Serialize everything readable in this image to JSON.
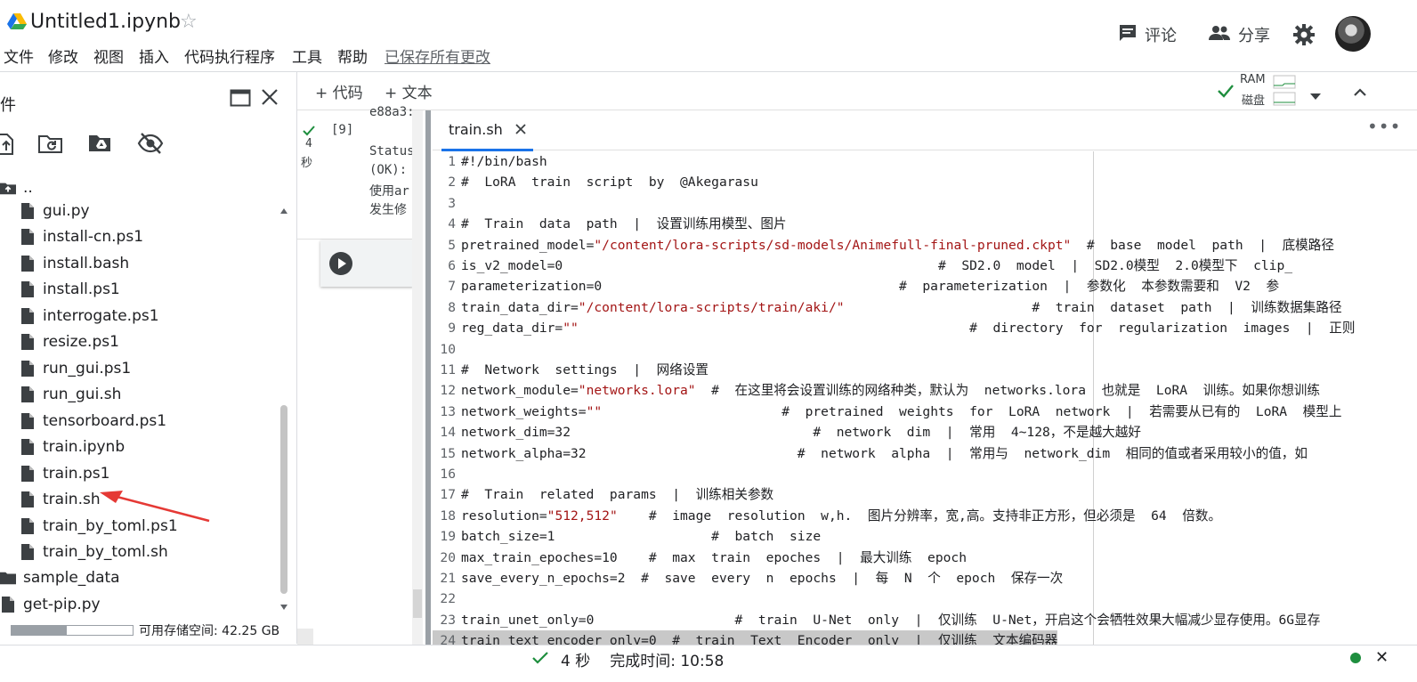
{
  "header": {
    "title": "Untitled1.ipynb",
    "menu": [
      "文件",
      "修改",
      "视图",
      "插入",
      "代码执行程序",
      "工具",
      "帮助"
    ],
    "saved_status": "已保存所有更改",
    "comment_label": "评论",
    "share_label": "分享"
  },
  "sidebar": {
    "title": "件",
    "parent_label": "..",
    "files": [
      "gui.py",
      "install-cn.ps1",
      "install.bash",
      "install.ps1",
      "interrogate.ps1",
      "resize.ps1",
      "run_gui.ps1",
      "run_gui.sh",
      "tensorboard.ps1",
      "train.ipynb",
      "train.ps1",
      "train.sh",
      "train_by_toml.ps1",
      "train_by_toml.sh"
    ],
    "folder": "sample_data",
    "extra_file": "get-pip.py",
    "storage_label": "可用存储空间: 42.25 GB"
  },
  "toolbar": {
    "add_code": "+ 代码",
    "add_text": "+ 文本",
    "ram_label": "RAM",
    "disk_label": "磁盘"
  },
  "cell": {
    "exec_count": "[9]",
    "duration_value": "4",
    "duration_unit": "秒",
    "output_lines": [
      "e88a3:",
      "Status",
      "(OK):",
      "使用ar",
      "发生修"
    ]
  },
  "editor": {
    "tab_name": "train.sh",
    "lines": [
      {
        "n": "1",
        "t": "#!/bin/bash"
      },
      {
        "n": "2",
        "t": "#  LoRA  train  script  by  @Akegarasu"
      },
      {
        "n": "3",
        "t": ""
      },
      {
        "n": "4",
        "t": "#  Train  data  path  |  设置训练用模型、图片"
      },
      {
        "n": "5",
        "pre": "pretrained_model=",
        "s": "\"/content/lora-scripts/sd-models/Animefull-final-pruned.ckpt\"",
        "post": "  #  base  model  path  |  底模路径"
      },
      {
        "n": "6",
        "t": "is_v2_model=0                                                #  SD2.0  model  |  SD2.0模型  2.0模型下  clip_"
      },
      {
        "n": "7",
        "t": "parameterization=0                                      #  parameterization  |  参数化  本参数需要和  V2  参"
      },
      {
        "n": "8",
        "pre": "train_data_dir=",
        "s": "\"/content/lora-scripts/train/aki/\"",
        "post": "                        #  train  dataset  path  |  训练数据集路径"
      },
      {
        "n": "9",
        "pre": "reg_data_dir=",
        "s": "\"\"",
        "post": "                                                  #  directory  for  regularization  images  |  正则"
      },
      {
        "n": "10",
        "t": ""
      },
      {
        "n": "11",
        "t": "#  Network  settings  |  网络设置"
      },
      {
        "n": "12",
        "pre": "network_module=",
        "s": "\"networks.lora\"",
        "post": "  #  在这里将会设置训练的网络种类，默认为  networks.lora  也就是  LoRA  训练。如果你想训练"
      },
      {
        "n": "13",
        "pre": "network_weights=",
        "s": "\"\"",
        "post": "                       #  pretrained  weights  for  LoRA  network  |  若需要从已有的  LoRA  模型上"
      },
      {
        "n": "14",
        "t": "network_dim=32                               #  network  dim  |  常用  4~128，不是越大越好"
      },
      {
        "n": "15",
        "t": "network_alpha=32                           #  network  alpha  |  常用与  network_dim  相同的值或者采用较小的值，如"
      },
      {
        "n": "16",
        "t": ""
      },
      {
        "n": "17",
        "t": "#  Train  related  params  |  训练相关参数"
      },
      {
        "n": "18",
        "pre": "resolution=",
        "s": "\"512,512\"",
        "post": "    #  image  resolution  w,h.  图片分辨率，宽,高。支持非正方形，但必须是  64  倍数。"
      },
      {
        "n": "19",
        "t": "batch_size=1                    #  batch  size"
      },
      {
        "n": "20",
        "t": "max_train_epoches=10    #  max  train  epoches  |  最大训练  epoch"
      },
      {
        "n": "21",
        "t": "save_every_n_epochs=2  #  save  every  n  epochs  |  每  N  个  epoch  保存一次"
      },
      {
        "n": "22",
        "t": ""
      },
      {
        "n": "23",
        "t": "train_unet_only=0                  #  train  U-Net  only  |  仅训练  U-Net，开启这个会牺牲效果大幅减少显存使用。6G显存"
      },
      {
        "n": "24",
        "t": "train_text_encoder_only=0  #  train  Text  Encoder  only  |  仅训练  文本编码器"
      }
    ]
  },
  "status": {
    "duration": "4 秒",
    "completed": "完成时间: 10:58"
  }
}
